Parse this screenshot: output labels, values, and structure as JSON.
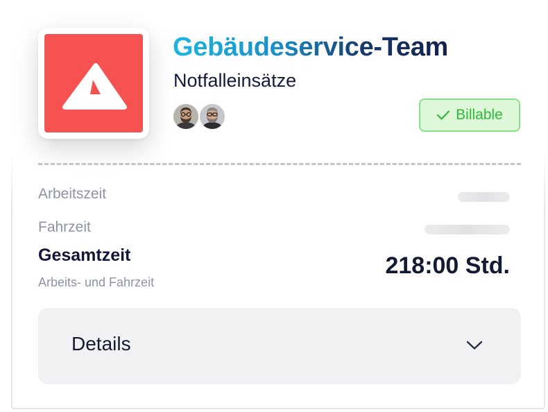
{
  "team": {
    "title": "Gebäudeservice-Team",
    "subtitle": "Notfalleinsätze",
    "logo_color": "#f75252",
    "members": [
      {
        "icon": "avatar-man-glasses-beard"
      },
      {
        "icon": "avatar-man-glasses-grey-beard"
      }
    ]
  },
  "badge": {
    "label": "Billable",
    "icon": "check-icon",
    "color": "#2dbb38",
    "background": "#def7d9"
  },
  "time": {
    "rows": [
      {
        "label": "Arbeitszeit",
        "value_state": "loading"
      },
      {
        "label": "Fahrzeit",
        "value_state": "loading"
      }
    ],
    "total_label": "Gesamtzeit",
    "total_sublabel": "Arbeits- und Fahrzeit",
    "total_value": "218:00 Std."
  },
  "details": {
    "label": "Details",
    "state": "collapsed",
    "icon": "chevron-down-icon"
  }
}
